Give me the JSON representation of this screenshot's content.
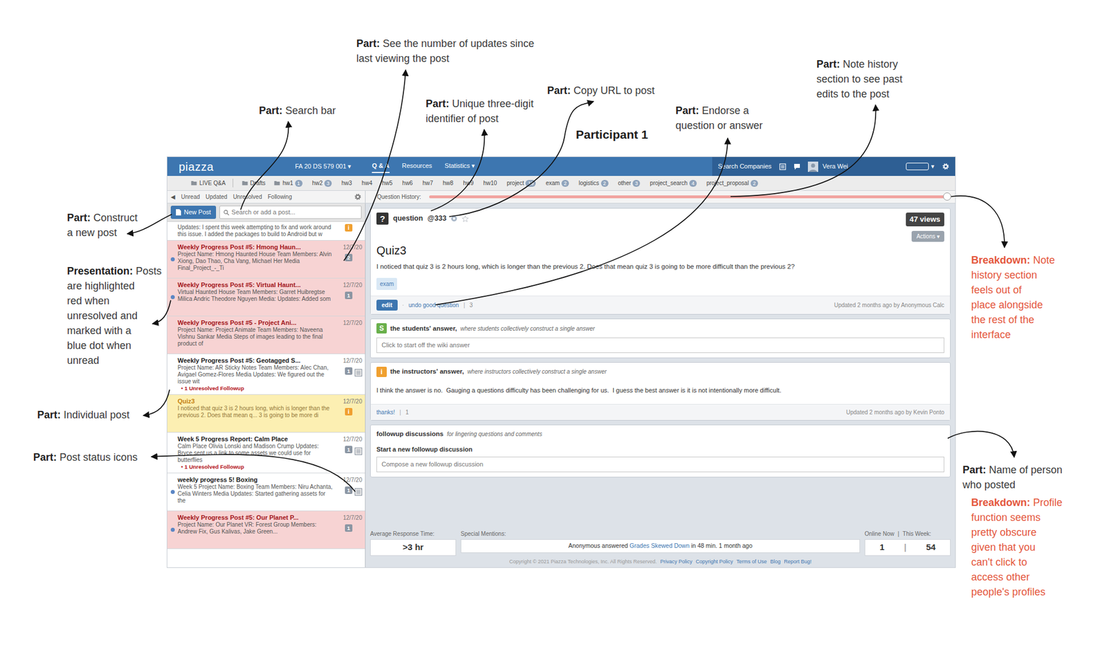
{
  "title": "Participant 1",
  "annotations": [
    {
      "kind": "part",
      "label": "Part:",
      "text": "Search bar"
    },
    {
      "kind": "part",
      "label": "Part:",
      "text": "See the number of updates since last viewing the post"
    },
    {
      "kind": "part",
      "label": "Part:",
      "text": "Unique three-digit identifier of post"
    },
    {
      "kind": "part",
      "label": "Part:",
      "text": "Copy URL to post"
    },
    {
      "kind": "part",
      "label": "Part:",
      "text": "Endorse a question or answer"
    },
    {
      "kind": "part",
      "label": "Part:",
      "text": "Note history section to see past edits to the post"
    },
    {
      "kind": "breakdown",
      "label": "Breakdown:",
      "text": "Note history section feels out of place alongside the rest of the interface"
    },
    {
      "kind": "part",
      "label": "Part:",
      "text": "Name of person who posted"
    },
    {
      "kind": "breakdown",
      "label": "Breakdown:",
      "text": "Profile function seems pretty obscure given that you can't click to access other people's profiles"
    },
    {
      "kind": "part",
      "label": "Part:",
      "text": "Construct a new post"
    },
    {
      "kind": "presentation",
      "label": "Presentation:",
      "text": "Posts are highlighted red when unresolved and marked with a blue dot when unread"
    },
    {
      "kind": "part",
      "label": "Part:",
      "text": "Individual post"
    },
    {
      "kind": "part",
      "label": "Part:",
      "text": "Post status icons"
    }
  ],
  "app": {
    "logo": "piazza",
    "course": "FA 20 DS 579 001 ▾",
    "nav": [
      {
        "label": "Q & A",
        "selected": true
      },
      {
        "label": "Resources",
        "selected": false
      },
      {
        "label": "Statistics ▾",
        "selected": false
      }
    ],
    "search_companies": "Search Companies",
    "user": "Vera Wei",
    "user_caret": "▾",
    "folders": [
      {
        "label": "LIVE Q&A",
        "kind": "folder"
      },
      {
        "label": "Drafts",
        "kind": "folder"
      },
      {
        "label": "hw1",
        "kind": "folder",
        "count": "1"
      },
      {
        "label": "hw2",
        "kind": "tag",
        "count": "3"
      },
      {
        "label": "hw3",
        "kind": "tag"
      },
      {
        "label": "hw4",
        "kind": "tag"
      },
      {
        "label": "hw5",
        "kind": "tag"
      },
      {
        "label": "hw6",
        "kind": "tag"
      },
      {
        "label": "hw7",
        "kind": "tag"
      },
      {
        "label": "hw8",
        "kind": "tag"
      },
      {
        "label": "hw9",
        "kind": "tag"
      },
      {
        "label": "hw10",
        "kind": "tag"
      },
      {
        "label": "project",
        "kind": "tag",
        "count": "19"
      },
      {
        "label": "exam",
        "kind": "tag",
        "count": "2"
      },
      {
        "label": "logistics",
        "kind": "tag",
        "count": "2"
      },
      {
        "label": "other",
        "kind": "tag",
        "count": "3"
      },
      {
        "label": "project_search",
        "kind": "tag",
        "count": "4"
      },
      {
        "label": "project_proposal",
        "kind": "tag",
        "count": "2"
      }
    ],
    "filters": {
      "collapse": "◀",
      "items": [
        "Unread",
        "Updated",
        "Unresolved",
        "Following"
      ]
    },
    "history": {
      "label": "Question History:",
      "level": 1
    },
    "new_post": "New Post",
    "search": {
      "placeholder": "Search or add a post..."
    },
    "posts": [
      {
        "kind": "partial",
        "snippet": "Updates: I spent this week attempting to fix and work around this issue. I added the packages to build to Android but w",
        "icon": "i",
        "unread": false,
        "unresolved": false,
        "selected": false,
        "note": false
      },
      {
        "kind": "post",
        "title": "Weekly Progress Post #5: Hmong Haun...",
        "date": "12/7/20",
        "snippet": "Project Name: Hmong Haunted House Team Members: Alvin Xiong, Dao Thao, Cha Vang, Michael Her Media Final_Project_-_Ti",
        "badge": "2",
        "unread": true,
        "unresolved": true,
        "selected": false,
        "note": false
      },
      {
        "kind": "post",
        "title": "Weekly Progress Post #5: Virtual Haunt...",
        "date": "12/7/20",
        "snippet": "Virtual Haunted House Team Members: Garret Huibregtse Milica Andric Theodore Nguyen Media: Updates: Added som",
        "badge": "1",
        "unread": true,
        "unresolved": true,
        "selected": false,
        "note": false
      },
      {
        "kind": "post",
        "title": "Weekly Progress Post #5 - Project Ani...",
        "date": "12/7/20",
        "snippet": "Project Name: Project Animate Team Members: Naveena Vishnu Sankar Media Steps of images leading to the final product of",
        "unread": false,
        "unresolved": true,
        "selected": false,
        "note": false
      },
      {
        "kind": "post",
        "title": "Weekly Progress Post #5: Geotagged S...",
        "date": "12/7/20",
        "snippet": "Project Name: AR Sticky Notes Team Members: Alec Chan, Avigael Gomez-Flores Media Updates: We figured out the issue wit",
        "followup": "• 1 Unresolved Followup",
        "badge": "1",
        "unread": false,
        "unresolved": false,
        "selected": false,
        "note": true
      },
      {
        "kind": "post",
        "title": "Quiz3",
        "date": "12/7/20",
        "snippet": "I noticed that quiz 3 is 2 hours long, which is longer than the previous 2. Does that mean q... 3 is going to be more di",
        "icon": "i",
        "unread": false,
        "unresolved": false,
        "selected": true,
        "note": false
      },
      {
        "kind": "post",
        "title": "Week 5 Progress Report: Calm Place",
        "date": "12/7/20",
        "snippet": "Calm Place Olivia Lonski and Madison Crump Updates: Bryce sent us a link to some assets we could use for butterflies",
        "followup": "• 1 Unresolved Followup",
        "badge": "1",
        "unread": false,
        "unresolved": false,
        "selected": false,
        "note": true
      },
      {
        "kind": "post",
        "title": "weekly progress 5! Boxing",
        "date": "12/7/20",
        "snippet": "Week 5 Project Name: Boxing Team Members: Niru Achanta, Celia Winters Media Updates: Started gathering assets for the",
        "badge": "1",
        "unread": true,
        "unresolved": false,
        "selected": false,
        "note": true
      },
      {
        "kind": "post",
        "title": "Weekly Progress Post #5: Our Planet P...",
        "date": "12/7/20",
        "snippet": "Project Name: Our Planet VR: Forest Group Members: Andrew Fix, Gus Kalivas, Jake Green...",
        "badge": "1",
        "unread": true,
        "unresolved": true,
        "selected": false,
        "note": false
      }
    ],
    "question": {
      "icon": "?",
      "type": "question",
      "number": "@333",
      "views": "47 views",
      "actions": "Actions ▾",
      "title": "Quiz3",
      "body": "I noticed that quiz 3 is 2 hours long, which is longer than the previous 2. Does that mean quiz 3 is going to be more difficult than the previous 2?",
      "tags": [
        "exam"
      ],
      "edit": "edit",
      "dot": "·",
      "endorse": "undo good question",
      "sep": "|",
      "endorse_count": "3",
      "updated": "Updated 2 months ago by Anonymous Calc"
    },
    "students_answer": {
      "icon": "S",
      "title": "the students' answer,",
      "subtitle": "where students collectively construct a single answer",
      "placeholder": "Click to start off the wiki answer"
    },
    "instructors_answer": {
      "icon": "i",
      "title": "the instructors' answer,",
      "subtitle": "where instructors collectively construct a single answer",
      "body": "I think the answer is no.  Gauging a questions difficulty has been challenging for us.  I guess the best answer is it is not intentionally more difficult.",
      "thanks": "thanks!",
      "sep": "|",
      "thanks_count": "1",
      "updated": "Updated 2 months ago by Kevin Ponto"
    },
    "followups": {
      "title": "followup discussions",
      "subtitle": "for lingering questions and comments",
      "start": "Start a new followup discussion",
      "placeholder": "Compose a new followup discussion"
    },
    "stats": {
      "avg_label": "Average Response Time:",
      "avg_value": ">3 hr",
      "mentions_label": "Special Mentions:",
      "mention_before": "Anonymous answered ",
      "mention_link": "Grades Skewed Down",
      "mention_after": " in 48 min. 1 month ago",
      "online_label": "Online Now",
      "sep": "|",
      "week_label": "This Week:",
      "online": "1",
      "week": "54"
    },
    "copyright": {
      "text": "Copyright © 2021 Piazza Technologies, Inc. All Rights Reserved.",
      "links": [
        "Privacy Policy",
        "Copyright Policy",
        "Terms of Use",
        "Blog",
        "Report Bug!"
      ]
    }
  }
}
